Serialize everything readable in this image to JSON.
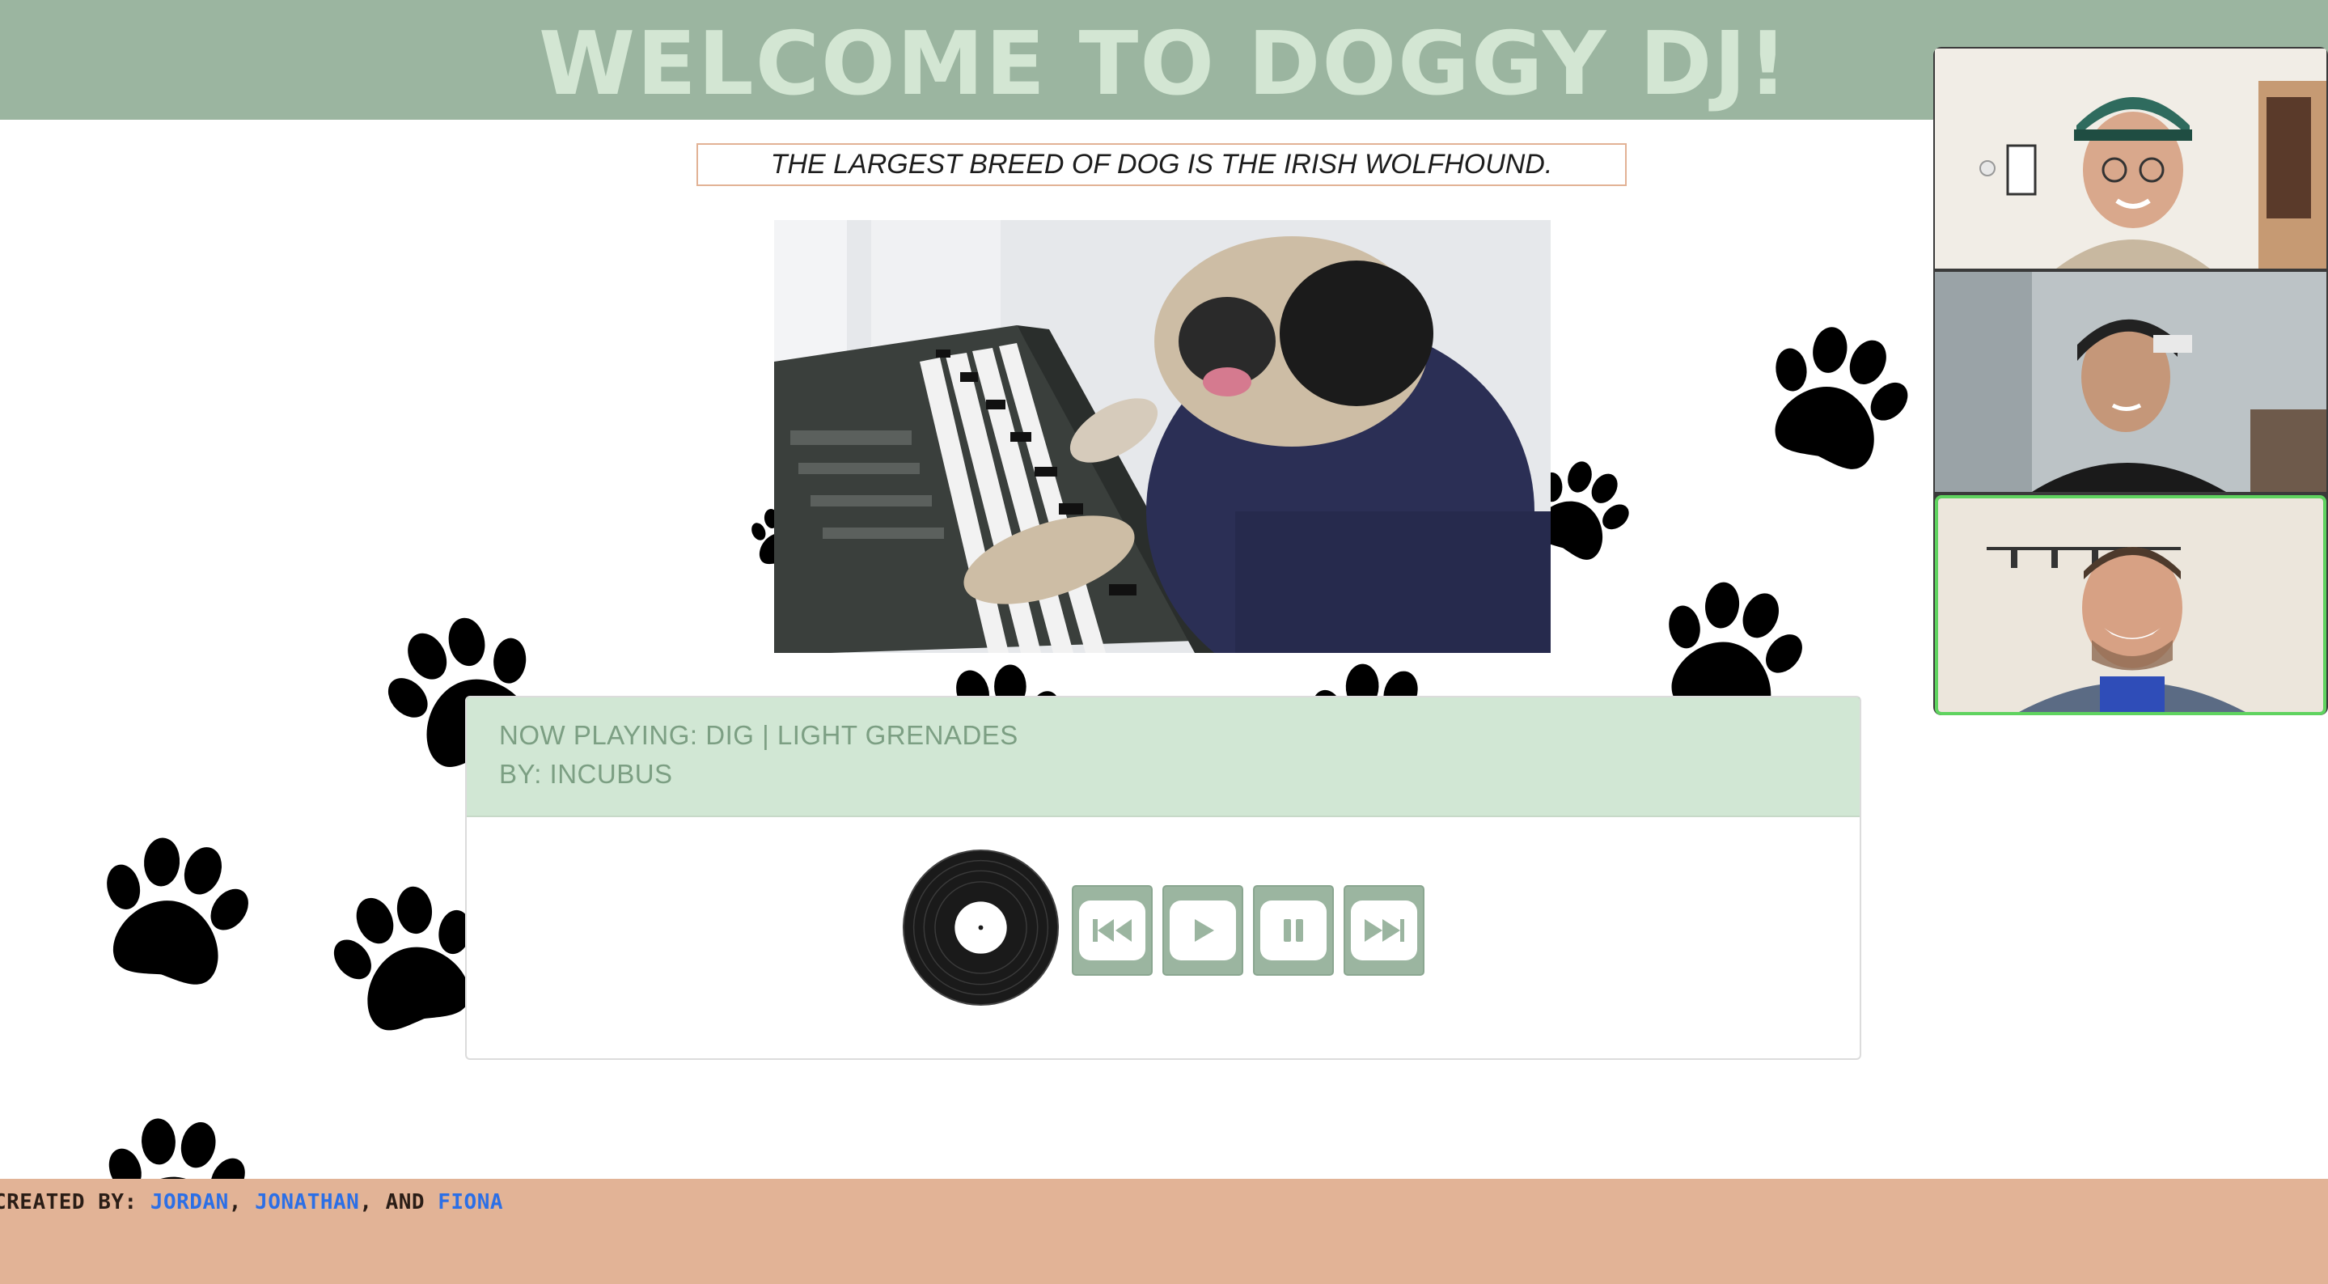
{
  "header": {
    "title": "WELCOME TO DOGGY DJ!"
  },
  "fact": {
    "text": "THE LARGEST BREED OF DOG IS THE IRISH WOLFHOUND."
  },
  "media": {
    "image": "pug-playing-keyboard-gif"
  },
  "player": {
    "now_playing": "NOW PLAYING: DIG | LIGHT GRENADES",
    "artist": "BY: INCUBUS",
    "controls": [
      {
        "icon": "skip-back-icon"
      },
      {
        "icon": "play-icon"
      },
      {
        "icon": "pause-icon"
      },
      {
        "icon": "fast-forward-icon"
      }
    ]
  },
  "footer": {
    "prefix": "CREATED BY: ",
    "name1": "JORDAN",
    "sep1": ", ",
    "name2": "JONATHAN",
    "sep2": ", AND ",
    "name3": "FIONA"
  },
  "colors": {
    "header_bg": "#9bb5a0",
    "title_text": "#d3e6d3",
    "footer_bg": "#e2b396",
    "link": "#2c6fe6",
    "accent_border": "#e2b295",
    "active_speaker": "#5fd35f"
  }
}
